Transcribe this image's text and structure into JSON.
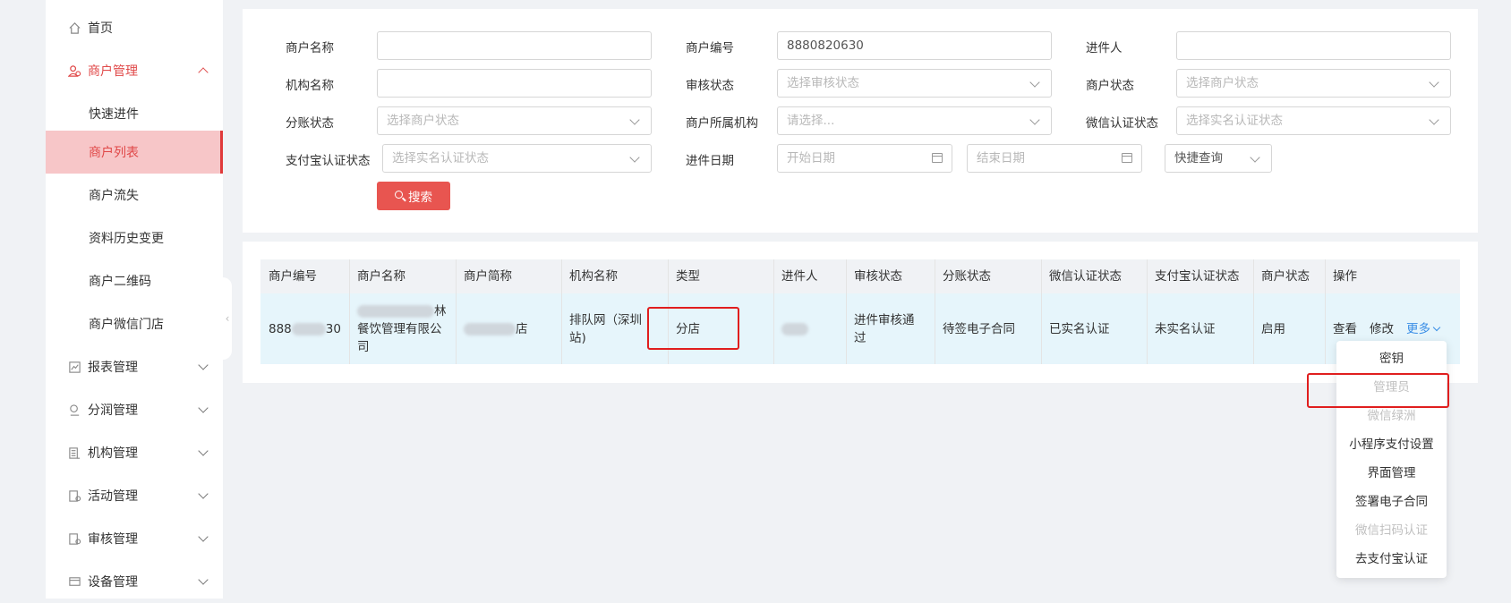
{
  "sidebar": {
    "items": [
      {
        "label": "首页",
        "icon": "home-icon"
      },
      {
        "label": "商户管理",
        "icon": "merchant-icon"
      },
      {
        "label": "快速进件"
      },
      {
        "label": "商户列表"
      },
      {
        "label": "商户流失"
      },
      {
        "label": "资料历史变更"
      },
      {
        "label": "商户二维码"
      },
      {
        "label": "商户微信门店"
      },
      {
        "label": "报表管理",
        "icon": "report-icon"
      },
      {
        "label": "分润管理",
        "icon": "profit-icon"
      },
      {
        "label": "机构管理",
        "icon": "org-icon"
      },
      {
        "label": "活动管理",
        "icon": "activity-icon"
      },
      {
        "label": "审核管理",
        "icon": "audit-icon"
      },
      {
        "label": "设备管理",
        "icon": "device-icon"
      }
    ],
    "collapse_glyph": "‹"
  },
  "filters": {
    "merchant_name": {
      "label": "商户名称",
      "value": ""
    },
    "merchant_no": {
      "label": "商户编号",
      "value": "8880820630"
    },
    "applicant": {
      "label": "进件人",
      "value": ""
    },
    "org_name": {
      "label": "机构名称",
      "value": ""
    },
    "audit_status": {
      "label": "审核状态",
      "placeholder": "选择审核状态"
    },
    "merchant_status": {
      "label": "商户状态",
      "placeholder": "选择商户状态"
    },
    "split_status": {
      "label": "分账状态",
      "placeholder": "选择商户状态"
    },
    "merchant_org": {
      "label": "商户所属机构",
      "placeholder": "请选择..."
    },
    "wechat_auth": {
      "label": "微信认证状态",
      "placeholder": "选择实名认证状态"
    },
    "alipay_auth": {
      "label": "支付宝认证状态",
      "placeholder": "选择实名认证状态"
    },
    "entry_date": {
      "label": "进件日期",
      "start_placeholder": "开始日期",
      "end_placeholder": "结束日期"
    },
    "quick_query": {
      "value": "快捷查询"
    },
    "search_label": "搜索"
  },
  "table": {
    "headers": [
      "商户编号",
      "商户名称",
      "商户简称",
      "机构名称",
      "类型",
      "进件人",
      "审核状态",
      "分账状态",
      "微信认证状态",
      "支付宝认证状态",
      "商户状态",
      "操作"
    ],
    "row": {
      "merchant_no_prefix": "888",
      "merchant_no_suffix": "30",
      "name_line1_suffix": "林",
      "name_line2": "餐饮管理有限公",
      "name_line3": "司",
      "short_name_suffix": "店",
      "org_name_line1": "排队网（深圳",
      "org_name_line2": "站)",
      "type": "分店",
      "audit_line1": "进件审核通",
      "audit_line2": "过",
      "split_status": "待签电子合同",
      "wechat_status": "已实名认证",
      "alipay_status": "未实名认证",
      "merchant_status": "启用"
    },
    "actions": {
      "view": "查看",
      "edit": "修改",
      "more": "更多"
    }
  },
  "more_menu": [
    {
      "label": "密钥",
      "disabled": false
    },
    {
      "label": "管理员",
      "disabled": true
    },
    {
      "label": "微信绿洲",
      "disabled": true
    },
    {
      "label": "小程序支付设置",
      "disabled": false
    },
    {
      "label": "界面管理",
      "disabled": false
    },
    {
      "label": "签署电子合同",
      "disabled": false
    },
    {
      "label": "微信扫码认证",
      "disabled": true
    },
    {
      "label": "去支付宝认证",
      "disabled": false
    }
  ],
  "colors": {
    "accent": "#e04848",
    "active_bg": "#f7c6c8",
    "link": "#3a8ee6",
    "highlight": "#e01e1e"
  }
}
